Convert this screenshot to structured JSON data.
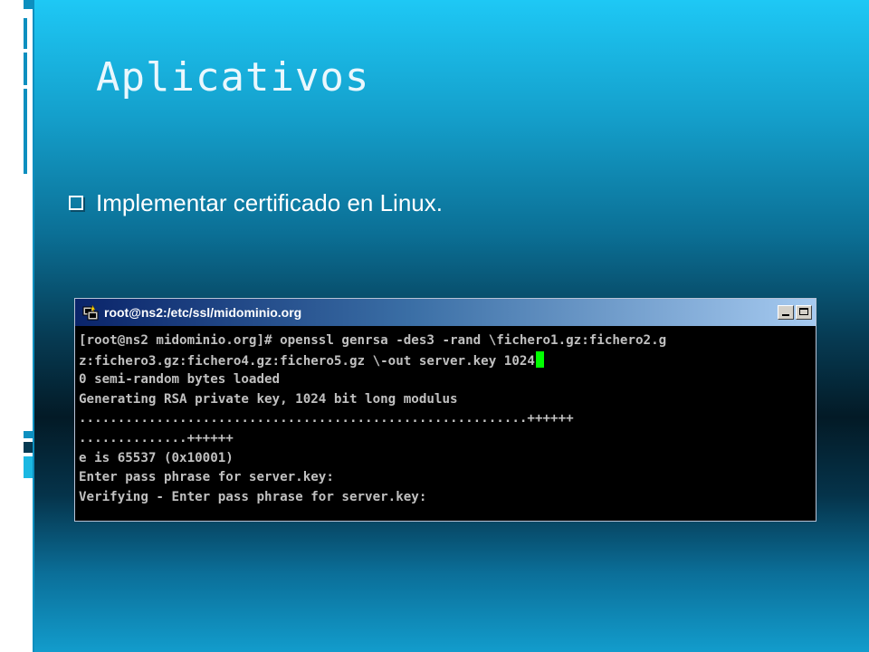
{
  "slide": {
    "title": "Aplicativos",
    "bullet": "Implementar certificado en Linux."
  },
  "terminal": {
    "window_title": "root@ns2:/etc/ssl/midominio.org",
    "lines": [
      "[root@ns2 midominio.org]# openssl genrsa -des3 -rand \\fichero1.gz:fichero2.g",
      "z:fichero3.gz:fichero4.gz:fichero5.gz \\-out server.key 1024",
      "0 semi-random bytes loaded",
      "Generating RSA private key, 1024 bit long modulus",
      "..........................................................++++++",
      "..............++++++",
      "e is 65537 (0x10001)",
      "Enter pass phrase for server.key:",
      "Verifying - Enter pass phrase for server.key:"
    ]
  },
  "colors": {
    "terminal_text": "#c0c0c0",
    "cursor": "#00ff00",
    "accent": "#1ec8f5"
  }
}
